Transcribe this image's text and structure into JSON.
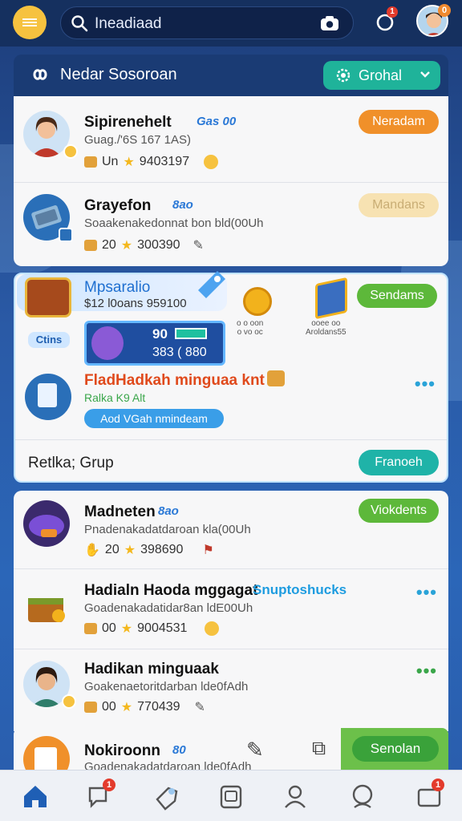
{
  "topbar": {
    "search_text": "Ineadiaad",
    "notif_badge": "1",
    "avatar_badge": "0"
  },
  "header": {
    "title": "Nedar Sosoroan",
    "button": "Grohal"
  },
  "items_top": [
    {
      "name": "Sipirenehelt",
      "tag": "Gas 00",
      "sub": "Guag./'6S 167 1AS)",
      "stat1": "Un",
      "stat2": "9403197",
      "pill": "Neradam",
      "pill_color": "#f0902a"
    },
    {
      "name": "Grayefon",
      "tag": "8ao",
      "sub": "Soaakenakedonnat bon bld(00Uh",
      "stat1": "20",
      "stat2": "300390",
      "pill": "Mandans",
      "pill_color": "#f7e2b2"
    }
  ],
  "featured": {
    "title": "Mpsaralio",
    "sub": "$12 l0oans 959100",
    "icon_label": "Ctins",
    "tile1": "o o oon\no vo oc",
    "tile2": "ooee oo\nAroldans55",
    "pill": "Sendams",
    "game_top": "90",
    "game_bottom": "383 ( 880",
    "item_name": "FladHadkah minguaa knt",
    "item_sub": "Ralka K9 Alt",
    "item_btn": "Aod VGah nmindeam",
    "footer_label": "Retlka; Grup",
    "footer_btn": "Franoeh"
  },
  "items_bottom": [
    {
      "name": "Madneten",
      "tag": "8ao",
      "sub": "Pnadenakadatdaroan kla(00Uh",
      "stat1": "20",
      "stat2": "398690",
      "pill": "Viokdents"
    },
    {
      "name": "Hadialn Haoda mggagat",
      "tag": "Snuptoshucks",
      "sub": "Goadenakadatidar8an ldE00Uh",
      "stat1": "00",
      "stat2": "9004531"
    },
    {
      "name": "Hadikan minguaak",
      "sub": "Goakenaetoritdarban lde0fAdh",
      "stat1": "00",
      "stat2": "770439"
    },
    {
      "name": "Nokiroonn",
      "tag": "80",
      "sub": "Goadenakadatdaroan lde0fAdh",
      "pill": "Senolan"
    }
  ],
  "nav": {
    "badge_msg": "1",
    "badge_last": "1"
  },
  "colors": {
    "accent_green": "#5db83a",
    "accent_teal": "#1fb39a",
    "accent_orange": "#f0902a",
    "topbar": "#15305f"
  }
}
